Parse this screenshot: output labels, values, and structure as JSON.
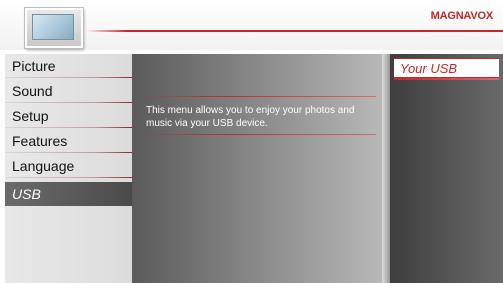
{
  "header": {
    "brand": "MAGNAVOX",
    "icon": "tv-icon"
  },
  "menu": {
    "items": [
      {
        "label": "Picture",
        "selected": false
      },
      {
        "label": "Sound",
        "selected": false
      },
      {
        "label": "Setup",
        "selected": false
      },
      {
        "label": "Features",
        "selected": false
      },
      {
        "label": "Language",
        "selected": false
      },
      {
        "label": "USB",
        "selected": true
      }
    ]
  },
  "center": {
    "description": "This menu allows you to enjoy your photos and music via your USB device."
  },
  "right": {
    "items": [
      {
        "label": "Your USB",
        "selected": true
      }
    ]
  },
  "colors": {
    "accent": "#c0282b",
    "selected_bg": "#4a4a4a"
  }
}
